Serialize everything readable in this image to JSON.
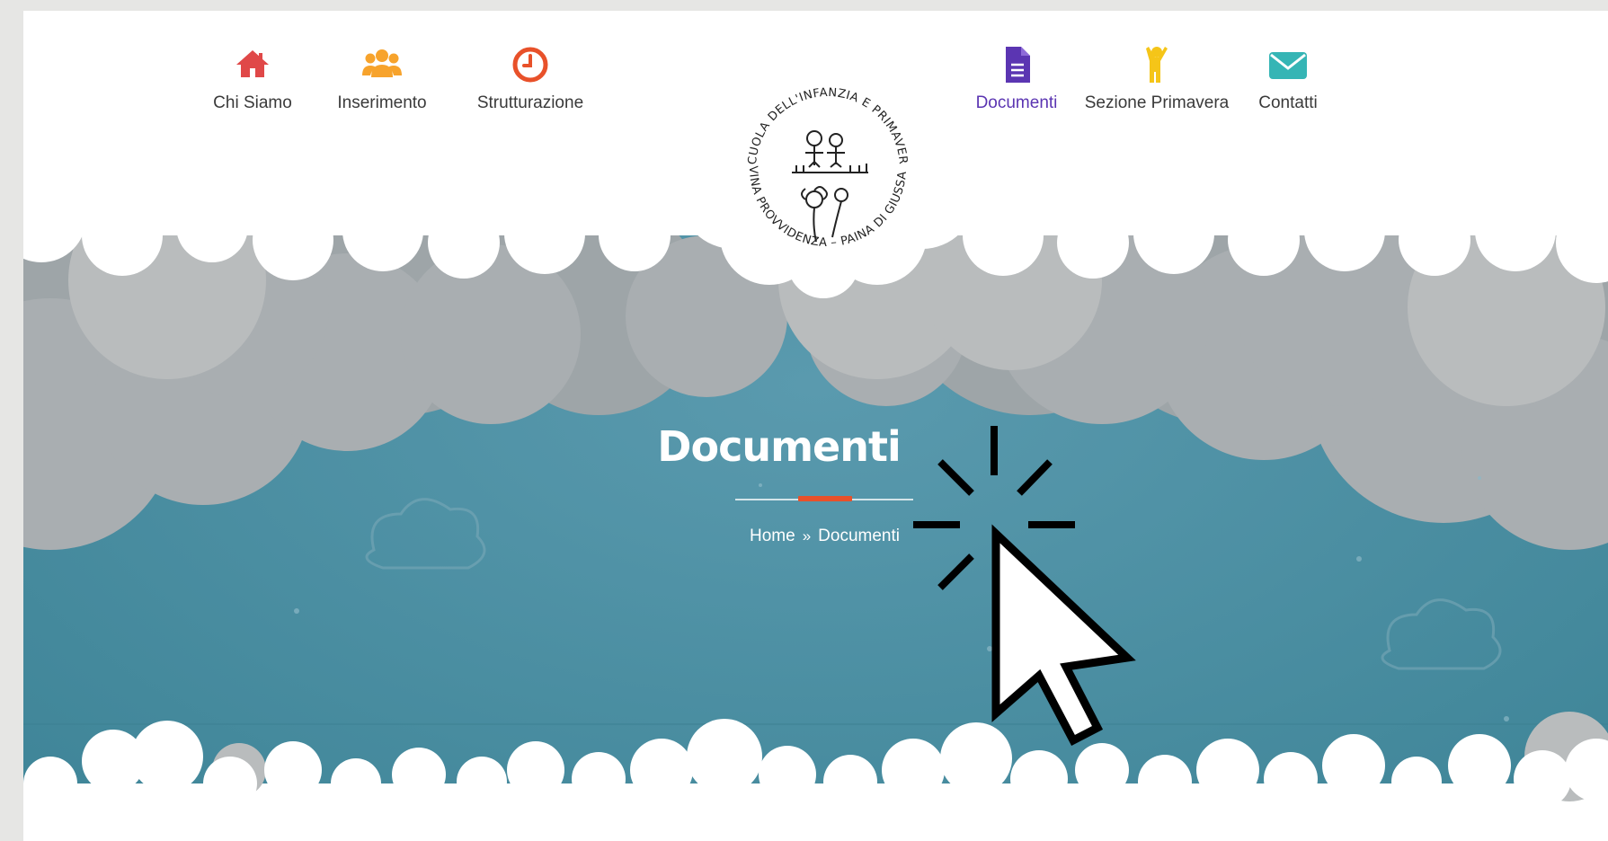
{
  "nav": {
    "left": [
      {
        "label": "Chi Siamo",
        "icon": "home-icon",
        "color": "#e04848"
      },
      {
        "label": "Inserimento",
        "icon": "users-icon",
        "color": "#f7a32c"
      },
      {
        "label": "Strutturazione",
        "icon": "clock-icon",
        "color": "#e8512a"
      }
    ],
    "right": [
      {
        "label": "Documenti",
        "icon": "document-icon",
        "color": "#5b35b2",
        "active": true
      },
      {
        "label": "Sezione Primavera",
        "icon": "child-icon",
        "color": "#f5c518"
      },
      {
        "label": "Contatti",
        "icon": "envelope-icon",
        "color": "#35b5b5"
      }
    ]
  },
  "logo": {
    "ring_text_top": "SCUOLA DELL'INFANZIA E PRIMAVERA",
    "ring_text_bottom": "DIVINA PROVVIDENZA – PAINA DI GIUSSANO"
  },
  "hero": {
    "title": "Documenti",
    "breadcrumb": {
      "home": "Home",
      "separator": "»",
      "current": "Documenti"
    },
    "colors": {
      "sky": "#4a8ea3",
      "accent": "#e8512a",
      "cloud_gray": "#a8aeb1"
    }
  },
  "overlay": {
    "icon": "click-cursor-icon"
  }
}
